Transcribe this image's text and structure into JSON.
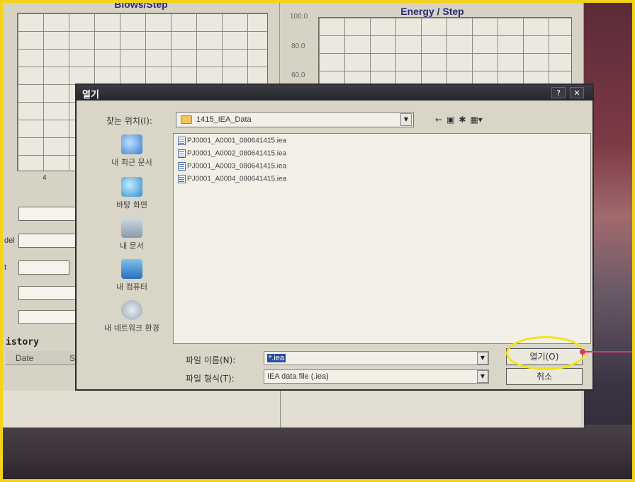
{
  "dialog": {
    "title": "열기",
    "help_btn": "?",
    "close_btn": "✕",
    "look_in_label": "찾는 위치(I):",
    "look_in_value": "1415_IEA_Data",
    "nav_icons": [
      "back-icon",
      "up-folder-icon",
      "new-folder-icon",
      "view-menu-icon"
    ],
    "places": [
      {
        "label": "내 최근 문서",
        "icon": "recent-documents-icon",
        "color": "#3a7ed0"
      },
      {
        "label": "바탕 화면",
        "icon": "desktop-icon",
        "color": "#2f8fcf"
      },
      {
        "label": "내 문서",
        "icon": "my-documents-icon",
        "color": "#8a9aaa"
      },
      {
        "label": "내 컴퓨터",
        "icon": "my-computer-icon",
        "color": "#3a8ed8"
      },
      {
        "label": "내 네트워크 환경",
        "icon": "network-icon",
        "color": "#9aa6b2"
      }
    ],
    "files": [
      "PJ0001_A0001_080641415.iea",
      "PJ0001_A0002_080641415.iea",
      "PJ0001_A0003_080641415.iea",
      "PJ0001_A0004_080641415.iea"
    ],
    "file_name_label": "파일 이름(N):",
    "file_name_value_selected": "*.iea",
    "file_type_label": "파일 형식(T):",
    "file_type_value": "IEA data file (.iea)",
    "open_button": "열기(O)",
    "cancel_button": "취소"
  },
  "background_app": {
    "left_chart_title": "Blows/Step",
    "right_chart_title": "Energy / Step",
    "right_y_ticks": [
      "100.0",
      "80.0",
      "60.0"
    ],
    "left_x_tick": "4",
    "field_label_1": "del",
    "field_label_2": "t",
    "history_title": "istory",
    "history_col_date": "Date",
    "history_col_st": "St"
  },
  "colors": {
    "highlight_circle": "#f2e21a",
    "pointer": "#e0307a",
    "frame": "#f2d21a"
  }
}
